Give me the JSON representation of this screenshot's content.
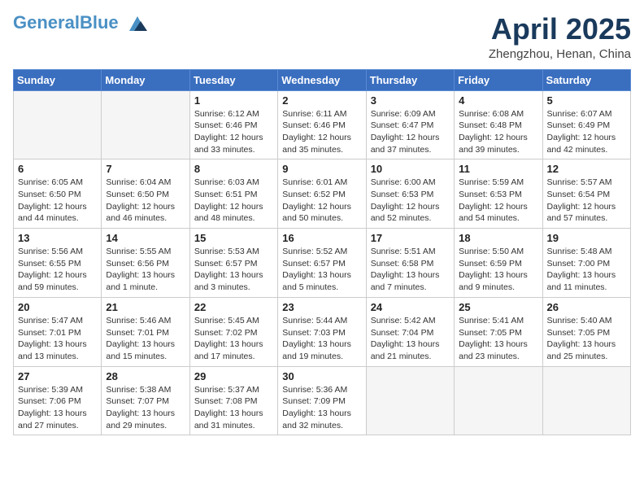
{
  "header": {
    "logo_line1": "General",
    "logo_line2": "Blue",
    "month_title": "April 2025",
    "location": "Zhengzhou, Henan, China"
  },
  "days_of_week": [
    "Sunday",
    "Monday",
    "Tuesday",
    "Wednesday",
    "Thursday",
    "Friday",
    "Saturday"
  ],
  "weeks": [
    [
      {
        "day": "",
        "info": ""
      },
      {
        "day": "",
        "info": ""
      },
      {
        "day": "1",
        "info": "Sunrise: 6:12 AM\nSunset: 6:46 PM\nDaylight: 12 hours and 33 minutes."
      },
      {
        "day": "2",
        "info": "Sunrise: 6:11 AM\nSunset: 6:46 PM\nDaylight: 12 hours and 35 minutes."
      },
      {
        "day": "3",
        "info": "Sunrise: 6:09 AM\nSunset: 6:47 PM\nDaylight: 12 hours and 37 minutes."
      },
      {
        "day": "4",
        "info": "Sunrise: 6:08 AM\nSunset: 6:48 PM\nDaylight: 12 hours and 39 minutes."
      },
      {
        "day": "5",
        "info": "Sunrise: 6:07 AM\nSunset: 6:49 PM\nDaylight: 12 hours and 42 minutes."
      }
    ],
    [
      {
        "day": "6",
        "info": "Sunrise: 6:05 AM\nSunset: 6:50 PM\nDaylight: 12 hours and 44 minutes."
      },
      {
        "day": "7",
        "info": "Sunrise: 6:04 AM\nSunset: 6:50 PM\nDaylight: 12 hours and 46 minutes."
      },
      {
        "day": "8",
        "info": "Sunrise: 6:03 AM\nSunset: 6:51 PM\nDaylight: 12 hours and 48 minutes."
      },
      {
        "day": "9",
        "info": "Sunrise: 6:01 AM\nSunset: 6:52 PM\nDaylight: 12 hours and 50 minutes."
      },
      {
        "day": "10",
        "info": "Sunrise: 6:00 AM\nSunset: 6:53 PM\nDaylight: 12 hours and 52 minutes."
      },
      {
        "day": "11",
        "info": "Sunrise: 5:59 AM\nSunset: 6:53 PM\nDaylight: 12 hours and 54 minutes."
      },
      {
        "day": "12",
        "info": "Sunrise: 5:57 AM\nSunset: 6:54 PM\nDaylight: 12 hours and 57 minutes."
      }
    ],
    [
      {
        "day": "13",
        "info": "Sunrise: 5:56 AM\nSunset: 6:55 PM\nDaylight: 12 hours and 59 minutes."
      },
      {
        "day": "14",
        "info": "Sunrise: 5:55 AM\nSunset: 6:56 PM\nDaylight: 13 hours and 1 minute."
      },
      {
        "day": "15",
        "info": "Sunrise: 5:53 AM\nSunset: 6:57 PM\nDaylight: 13 hours and 3 minutes."
      },
      {
        "day": "16",
        "info": "Sunrise: 5:52 AM\nSunset: 6:57 PM\nDaylight: 13 hours and 5 minutes."
      },
      {
        "day": "17",
        "info": "Sunrise: 5:51 AM\nSunset: 6:58 PM\nDaylight: 13 hours and 7 minutes."
      },
      {
        "day": "18",
        "info": "Sunrise: 5:50 AM\nSunset: 6:59 PM\nDaylight: 13 hours and 9 minutes."
      },
      {
        "day": "19",
        "info": "Sunrise: 5:48 AM\nSunset: 7:00 PM\nDaylight: 13 hours and 11 minutes."
      }
    ],
    [
      {
        "day": "20",
        "info": "Sunrise: 5:47 AM\nSunset: 7:01 PM\nDaylight: 13 hours and 13 minutes."
      },
      {
        "day": "21",
        "info": "Sunrise: 5:46 AM\nSunset: 7:01 PM\nDaylight: 13 hours and 15 minutes."
      },
      {
        "day": "22",
        "info": "Sunrise: 5:45 AM\nSunset: 7:02 PM\nDaylight: 13 hours and 17 minutes."
      },
      {
        "day": "23",
        "info": "Sunrise: 5:44 AM\nSunset: 7:03 PM\nDaylight: 13 hours and 19 minutes."
      },
      {
        "day": "24",
        "info": "Sunrise: 5:42 AM\nSunset: 7:04 PM\nDaylight: 13 hours and 21 minutes."
      },
      {
        "day": "25",
        "info": "Sunrise: 5:41 AM\nSunset: 7:05 PM\nDaylight: 13 hours and 23 minutes."
      },
      {
        "day": "26",
        "info": "Sunrise: 5:40 AM\nSunset: 7:05 PM\nDaylight: 13 hours and 25 minutes."
      }
    ],
    [
      {
        "day": "27",
        "info": "Sunrise: 5:39 AM\nSunset: 7:06 PM\nDaylight: 13 hours and 27 minutes."
      },
      {
        "day": "28",
        "info": "Sunrise: 5:38 AM\nSunset: 7:07 PM\nDaylight: 13 hours and 29 minutes."
      },
      {
        "day": "29",
        "info": "Sunrise: 5:37 AM\nSunset: 7:08 PM\nDaylight: 13 hours and 31 minutes."
      },
      {
        "day": "30",
        "info": "Sunrise: 5:36 AM\nSunset: 7:09 PM\nDaylight: 13 hours and 32 minutes."
      },
      {
        "day": "",
        "info": ""
      },
      {
        "day": "",
        "info": ""
      },
      {
        "day": "",
        "info": ""
      }
    ]
  ]
}
